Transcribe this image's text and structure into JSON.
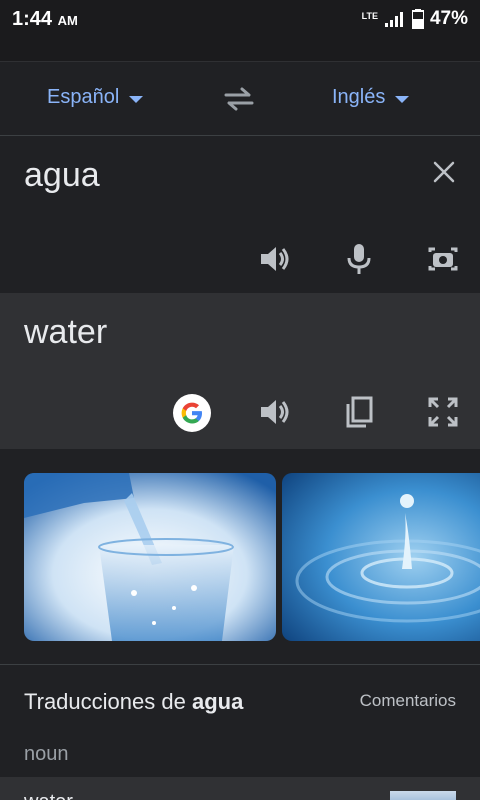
{
  "status": {
    "time": "1:44",
    "ampm": "AM",
    "network": "LTE",
    "battery": "47%"
  },
  "languages": {
    "source": "Español",
    "target": "Inglés"
  },
  "input": {
    "text": "agua"
  },
  "output": {
    "text": "water"
  },
  "translations": {
    "title_prefix": "Traducciones de ",
    "title_word": "agua",
    "feedback": "Comentarios",
    "part_of_speech": "noun",
    "first_word": "water"
  },
  "icons": {
    "swap": "swap-icon",
    "clear": "close-icon",
    "speaker": "speaker-icon",
    "mic": "microphone-icon",
    "camera": "camera-icon",
    "google": "google-logo-icon",
    "copy": "copy-icon",
    "fullscreen": "fullscreen-icon"
  },
  "colors": {
    "accent": "#8ab4f8",
    "background": "#202124",
    "surface": "#303134"
  }
}
